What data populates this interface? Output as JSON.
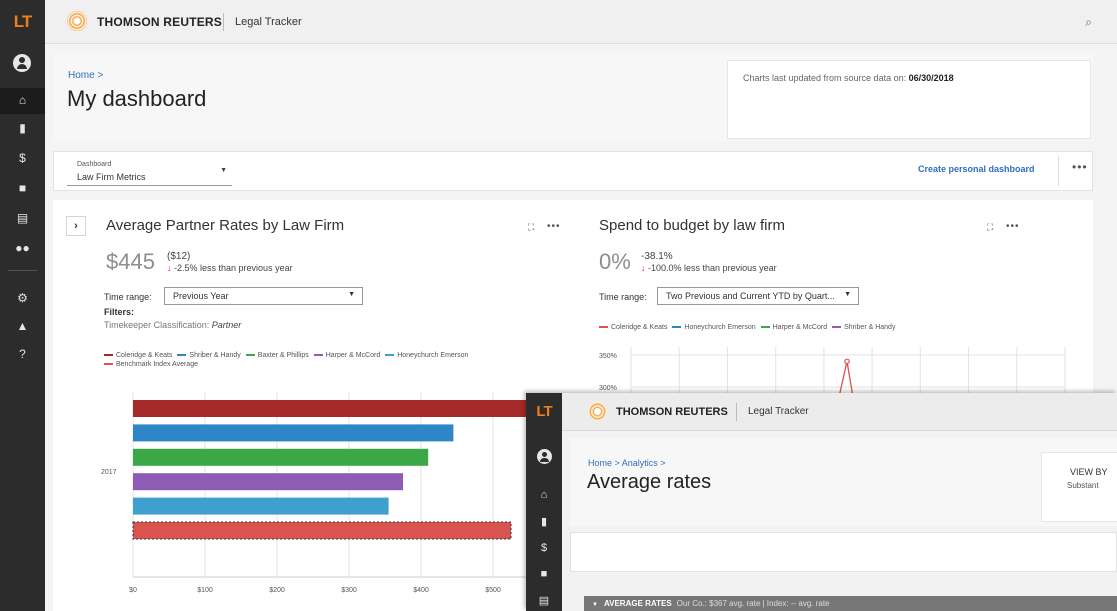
{
  "back_window": {
    "logo": "LT",
    "brand": "THOMSON REUTERS",
    "product": "Legal Tracker",
    "search_icon": "search-icon",
    "sidebar_icons": [
      "user-icon",
      "home-icon",
      "document-icon",
      "dollar-icon",
      "briefcase-icon",
      "reports-icon",
      "people-icon",
      "gear-icon",
      "bell-icon",
      "help-icon"
    ],
    "breadcrumb": "Home >",
    "page_title": "My dashboard",
    "updated_label": "Charts last updated from source data on:",
    "updated_date": "06/30/2018",
    "dashboard_select": {
      "label": "Dashboard",
      "value": "Law Firm Metrics"
    },
    "create_dashboard": "Create personal dashboard",
    "more": "•••"
  },
  "card_partner_rates": {
    "expand": "›",
    "title": "Average Partner Rates by Law Firm",
    "kpi_value": "$445",
    "kpi_delta": "($12)",
    "kpi_change": "-2.5% less than previous year",
    "time_range_label": "Time range:",
    "time_range_value": "Previous Year",
    "filters_label": "Filters:",
    "filter_name": "Timekeeper Classification:",
    "filter_value": "Partner",
    "legend": [
      {
        "name": "Coleridge & Keats",
        "color": "#a52a2a"
      },
      {
        "name": "Shriber & Handy",
        "color": "#2f86c6"
      },
      {
        "name": "Baxter & Phillips",
        "color": "#3aa846"
      },
      {
        "name": "Harper & McCord",
        "color": "#8e5bb5"
      },
      {
        "name": "Honeychurch Emerson",
        "color": "#3da0cf"
      },
      {
        "name": "Benchmark Index Average",
        "color": "#d9534f"
      }
    ]
  },
  "card_spend_budget": {
    "title": "Spend to budget by law firm",
    "kpi_value": "0%",
    "kpi_delta": "-38.1%",
    "kpi_change": "-100.0% less than previous year",
    "time_range_label": "Time range:",
    "time_range_value": "Two Previous and Current YTD by Quart...",
    "legend": [
      {
        "name": "Coleridge & Keats",
        "color": "#d9534f"
      },
      {
        "name": "Honeychurch Emerson",
        "color": "#2f86c6"
      },
      {
        "name": "Harper & McCord",
        "color": "#3aa846"
      },
      {
        "name": "Shriber & Handy",
        "color": "#8e5bb5"
      }
    ]
  },
  "chart_data": [
    {
      "type": "bar",
      "orientation": "horizontal",
      "categories": [
        "2017"
      ],
      "series": [
        {
          "name": "Coleridge & Keats",
          "values": [
            560
          ],
          "color": "#a52a2a"
        },
        {
          "name": "Shriber & Handy",
          "values": [
            445
          ],
          "color": "#2f86c6"
        },
        {
          "name": "Baxter & Phillips",
          "values": [
            410
          ],
          "color": "#3aa846"
        },
        {
          "name": "Harper & McCord",
          "values": [
            375
          ],
          "color": "#8e5bb5"
        },
        {
          "name": "Honeychurch Emerson",
          "values": [
            355
          ],
          "color": "#3da0cf"
        },
        {
          "name": "Benchmark Index Average",
          "values": [
            525
          ],
          "color": "#d9534f"
        }
      ],
      "x_ticks": [
        "$0",
        "$100",
        "$200",
        "$300",
        "$400",
        "$500"
      ],
      "xlim": [
        0,
        600
      ],
      "grid": true
    },
    {
      "type": "line",
      "y_ticks": [
        "350%",
        "300%"
      ],
      "ylim": [
        300,
        350
      ],
      "series": [
        {
          "name": "Coleridge & Keats",
          "color": "#d9534f",
          "peak_value": 340
        }
      ],
      "grid": true
    }
  ],
  "front_window": {
    "logo": "LT",
    "brand": "THOMSON REUTERS",
    "product": "Legal Tracker",
    "breadcrumb": "Home > Analytics >",
    "page_title": "Average rates",
    "view_by": "VIEW BY",
    "view_by_value": "Substant",
    "avg_rates_title": "AVERAGE RATES",
    "avg_rates_sub": "Our Co.: $367 avg. rate | Index: -- avg. rate"
  }
}
